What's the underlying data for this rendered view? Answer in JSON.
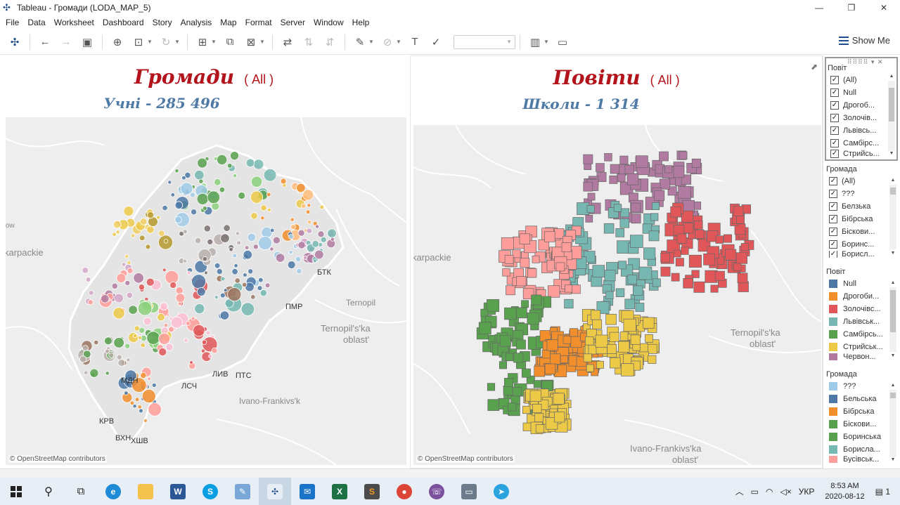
{
  "window": {
    "title": "Tableau - Громади (LODA_MAP_5)",
    "controls": {
      "minimize": "—",
      "restore": "❐",
      "close": "✕"
    }
  },
  "menu": [
    "File",
    "Data",
    "Worksheet",
    "Dashboard",
    "Story",
    "Analysis",
    "Map",
    "Format",
    "Server",
    "Window",
    "Help"
  ],
  "toolbar": {
    "show_me": "Show Me"
  },
  "left_view": {
    "title": "Громади",
    "filter_state": "( All )",
    "subtitle": "Учні - 285 496",
    "labels": {
      "btk": "БТК",
      "pmr": "ПМР",
      "mdn": "МДН",
      "lsch": "ЛСЧ",
      "liv": "ЛИВ",
      "pts": "ПТС",
      "krv": "КРВ",
      "vkhn": "ВХН",
      "khshv": "ХШВ",
      "karpackie": "karpackie",
      "ternopil": "Ternopil",
      "ternopil_oblast_1": "Ternopil's'ka",
      "ternopil_oblast_2": "oblast'",
      "ivano": "Ivano-Frankivs'k",
      "ow": "ow"
    },
    "attribution": "© OpenStreetMap contributors"
  },
  "right_view": {
    "title": "Повіти",
    "filter_state": "( All )",
    "subtitle": "Школи - 1 314",
    "labels": {
      "karpackie": "karpackie",
      "ternopil_oblast_1": "Ternopil's'ka",
      "ternopil_oblast_2": "oblast'",
      "ivano_oblast_1": "Ivano-Frankivs'ka",
      "ivano_oblast_2": "oblast'"
    },
    "attribution": "© OpenStreetMap contributors"
  },
  "filters": {
    "povit": {
      "header": "Повіт",
      "items": [
        "(All)",
        "Null",
        "Дрогоб...",
        "Золочів...",
        "Львівсь...",
        "Самбірс...",
        "Стрийсь..."
      ]
    },
    "gromada": {
      "header": "Громада",
      "items": [
        "(All)",
        "???",
        "Белзька",
        "Бібрська",
        "Біскови...",
        "Боринс...",
        "Борисл..."
      ]
    }
  },
  "legends": {
    "povit": {
      "header": "Повіт",
      "items": [
        {
          "label": "Null",
          "color": "#4e79a7"
        },
        {
          "label": "Дрогоби...",
          "color": "#f28e2b"
        },
        {
          "label": "Золочівс...",
          "color": "#e15759"
        },
        {
          "label": "Львівськ...",
          "color": "#76b7b2"
        },
        {
          "label": "Самбірсь...",
          "color": "#59a14f"
        },
        {
          "label": "Стрийськ...",
          "color": "#edc948"
        },
        {
          "label": "Червон...",
          "color": "#b07aa1"
        }
      ]
    },
    "gromada": {
      "header": "Громада",
      "items": [
        {
          "label": "???",
          "color": "#a0cbe8"
        },
        {
          "label": "Бельська",
          "color": "#4e79a7"
        },
        {
          "label": "Бібрська",
          "color": "#f28e2b"
        },
        {
          "label": "Біскови...",
          "color": "#59a14f"
        },
        {
          "label": "Боринська",
          "color": "#59a14f"
        },
        {
          "label": "Борисла...",
          "color": "#76b7b2"
        },
        {
          "label": "Бусівськ...",
          "color": "#ff9d9a"
        }
      ]
    }
  },
  "taskbar": {
    "lang": "УКР",
    "time": "8:53 AM",
    "date": "2020-08-12",
    "notifications": "1"
  }
}
